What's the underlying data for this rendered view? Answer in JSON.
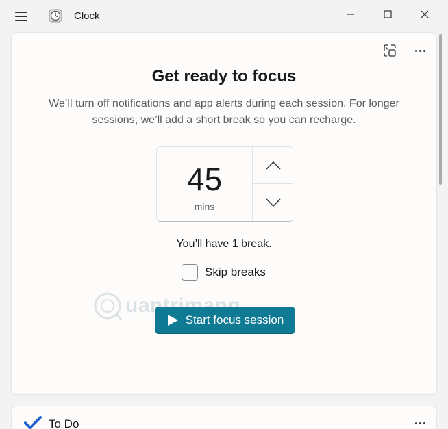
{
  "titlebar": {
    "app_title": "Clock"
  },
  "focus": {
    "title": "Get ready to focus",
    "description": "We’ll turn off notifications and app alerts during each session. For longer sessions, we’ll add a short break so you can recharge.",
    "timer_value": "45",
    "timer_unit": "mins",
    "break_text": "You’ll have 1 break.",
    "skip_breaks_label": "Skip breaks",
    "skip_breaks_checked": false,
    "start_button_label": "Start focus session"
  },
  "todo": {
    "title": "To Do"
  },
  "watermark": {
    "text": "uantrimang"
  },
  "colors": {
    "accent": "#0f7a94",
    "background": "#f3f3f3",
    "card": "#fdfcfb"
  },
  "icons": {
    "menu": "hamburger-icon",
    "app": "clock-app-icon",
    "minimize": "minimize-icon",
    "maximize": "maximize-icon",
    "close": "close-icon",
    "compact": "compact-overlay-icon",
    "more": "more-icon",
    "up": "chevron-up-icon",
    "down": "chevron-down-icon",
    "play": "play-icon",
    "todo": "todo-check-icon"
  }
}
